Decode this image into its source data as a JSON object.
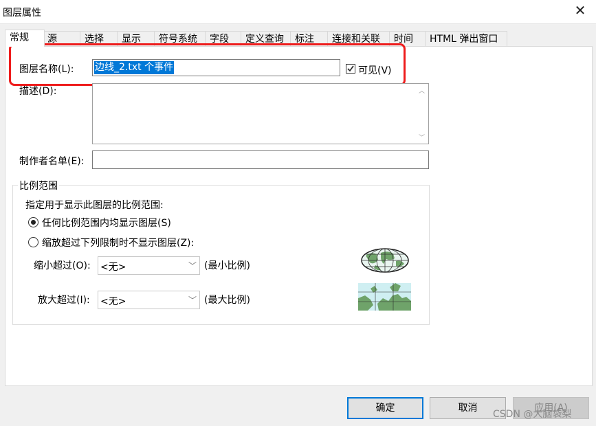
{
  "window": {
    "title": "图层属性",
    "close_symbol": "✕"
  },
  "tabs": [
    {
      "label": "常规",
      "active": true
    },
    {
      "label": "源"
    },
    {
      "label": "选择"
    },
    {
      "label": "显示"
    },
    {
      "label": "符号系统"
    },
    {
      "label": "字段"
    },
    {
      "label": "定义查询"
    },
    {
      "label": "标注"
    },
    {
      "label": "连接和关联"
    },
    {
      "label": "时间"
    },
    {
      "label": "HTML 弹出窗口"
    }
  ],
  "general": {
    "layer_name_label": "图层名称(L):",
    "layer_name_value": "边线_2.txt 个事件",
    "visible_label": "可见(V)",
    "visible_checked": true,
    "description_label": "描述(D):",
    "description_value": "",
    "credits_label": "制作者名单(E):",
    "credits_value": ""
  },
  "scale_range": {
    "group_title": "比例范围",
    "instruction": "指定用于显示此图层的比例范围:",
    "option_any": "任何比例范围内均显示图层(S)",
    "option_limit": "缩放超过下列限制时不显示图层(Z):",
    "selected": "any",
    "min_label": "缩小超过(O):",
    "min_value": "<无>",
    "min_hint": "(最小比例)",
    "max_label": "放大超过(I):",
    "max_value": "<无>",
    "max_hint": "(最大比例)"
  },
  "buttons": {
    "ok": "确定",
    "cancel": "取消",
    "apply": "应用(A)"
  },
  "watermark": "CSDN @大脑袋梨",
  "colors": {
    "selection": "#0078d7",
    "highlight_box": "#ee1c1c",
    "map_land": "#6fa36a",
    "map_water": "#cfeff2"
  }
}
